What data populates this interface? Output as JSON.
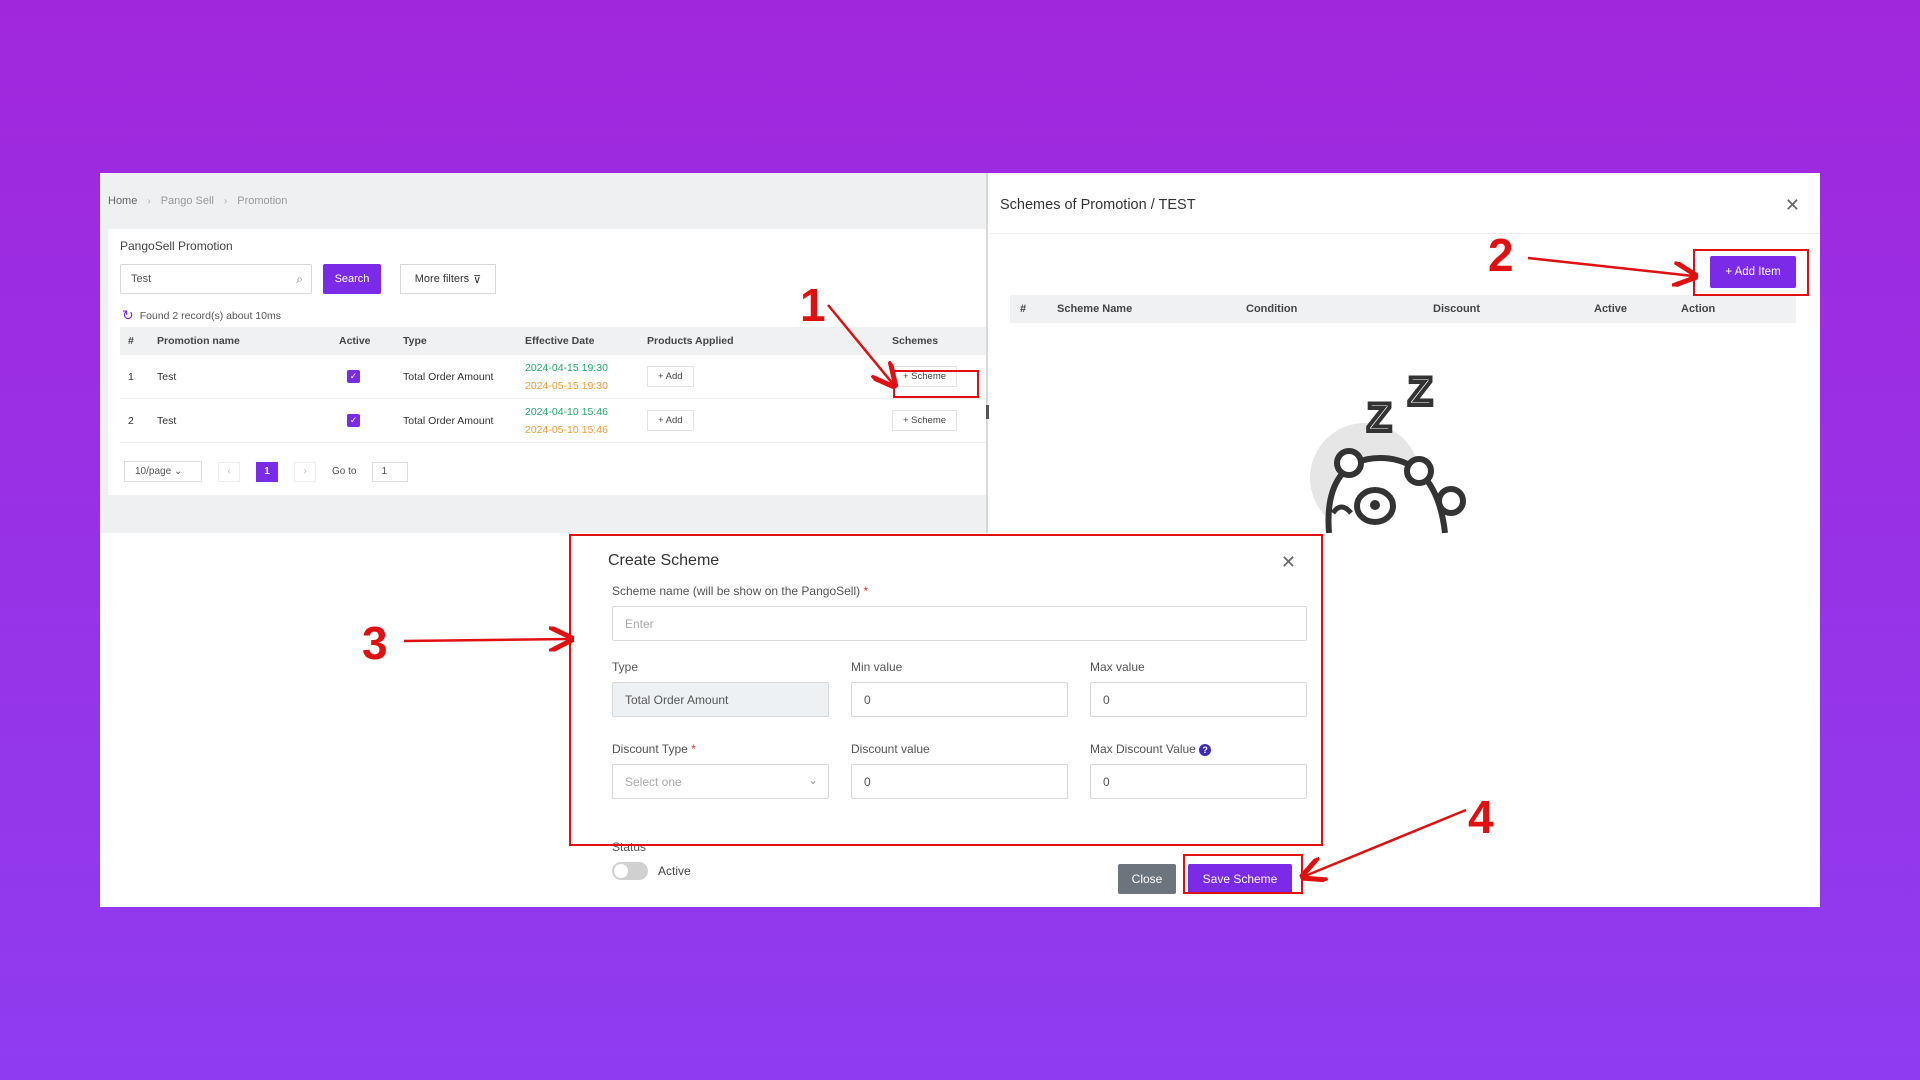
{
  "breadcrumb": [
    "Home",
    "Pango Sell",
    "Promotion"
  ],
  "list": {
    "title": "PangoSell Promotion",
    "search_value": "Test",
    "search_button": "Search",
    "more_filters": "More filters",
    "found_text": "Found 2 record(s) about 10ms",
    "columns": [
      "#",
      "Promotion name",
      "Active",
      "Type",
      "Effective Date",
      "Products Applied",
      "Schemes"
    ],
    "rows": [
      {
        "num": "1",
        "name": "Test",
        "type": "Total Order Amount",
        "start": "2024-04-15 19:30",
        "end": "2024-05-15 19:30",
        "products": "+ Add",
        "schemes": "+ Scheme"
      },
      {
        "num": "2",
        "name": "Test",
        "type": "Total Order Amount",
        "start": "2024-04-10 15:46",
        "end": "2024-05-10 15:46",
        "products": "+ Add",
        "schemes": "+ Scheme"
      }
    ],
    "pager": {
      "page_size": "10/page",
      "current": "1",
      "goto_label": "Go to",
      "goto_value": "1"
    }
  },
  "drawer": {
    "title": "Schemes of Promotion / TEST",
    "add_item": "+ Add Item",
    "columns": [
      "#",
      "Scheme Name",
      "Condition",
      "Discount",
      "Active",
      "Action"
    ]
  },
  "dialog": {
    "title": "Create Scheme",
    "scheme_name_label": "Scheme name (will be show on the PangoSell)",
    "scheme_name_placeholder": "Enter",
    "type_label": "Type",
    "type_value": "Total Order Amount",
    "min_label": "Min value",
    "min_value": "0",
    "max_label": "Max value",
    "max_value": "0",
    "discount_type_label": "Discount Type",
    "discount_type_placeholder": "Select one",
    "discount_value_label": "Discount value",
    "discount_value": "0",
    "max_discount_label": "Max Discount Value",
    "max_discount_value": "0",
    "status_label": "Status",
    "active_label": "Active",
    "close_button": "Close",
    "save_button": "Save Scheme",
    "required_mark": "*"
  },
  "annotations": [
    "1",
    "2",
    "3",
    "4"
  ],
  "colors": {
    "accent": "#7b2be8",
    "annotation": "#e01010",
    "background": "#9b30e6"
  },
  "icons": {
    "search": "search-icon",
    "filter": "filter-icon",
    "refresh": "refresh-icon",
    "close": "close-icon",
    "help": "help-icon",
    "chevron": "chevron-down-icon",
    "empty": "sleeping-panda-illustration"
  }
}
